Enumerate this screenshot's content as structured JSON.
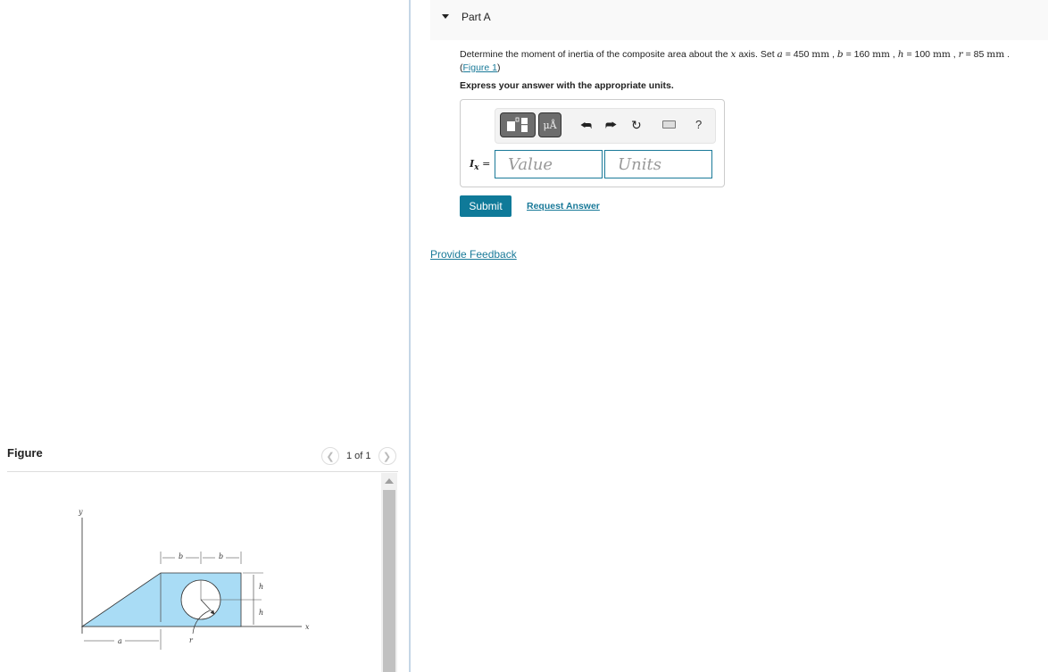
{
  "figure_panel": {
    "title": "Figure",
    "pagination": "1 of 1",
    "prev_icon": "chevron-left-icon",
    "next_icon": "chevron-right-icon",
    "diagram_labels": {
      "y_axis": "y",
      "x_axis": "x",
      "b1": "b",
      "b2": "b",
      "h1": "h",
      "h2": "h",
      "a": "a",
      "r": "r"
    },
    "fill_color": "#a9dcf5"
  },
  "part": {
    "title": "Part A",
    "caret_icon": "caret-down-icon",
    "problem_prefix": "Determine the moment of inertia of the composite area about the ",
    "axis_var": "x",
    "problem_axis_suffix": " axis. Set ",
    "params": [
      {
        "var": "a",
        "value": "450",
        "unit": "mm"
      },
      {
        "var": "b",
        "value": "160",
        "unit": "mm"
      },
      {
        "var": "h",
        "value": "100",
        "unit": "mm"
      },
      {
        "var": "r",
        "value": "85",
        "unit": "mm"
      }
    ],
    "figure_link": "Figure 1",
    "instruction": "Express your answer with the appropriate units."
  },
  "answer": {
    "toolbar": {
      "templates_icon": "templates-icon",
      "units_label": "μÅ",
      "undo_icon": "undo-icon",
      "redo_icon": "redo-icon",
      "reset_icon": "reset-icon",
      "keyboard_icon": "keyboard-icon",
      "help_label": "?"
    },
    "label_var": "I",
    "label_sub": "x",
    "label_eq": " =",
    "value_placeholder": "Value",
    "units_placeholder": "Units"
  },
  "actions": {
    "submit": "Submit",
    "request_answer": "Request Answer",
    "provide_feedback": "Provide Feedback"
  }
}
